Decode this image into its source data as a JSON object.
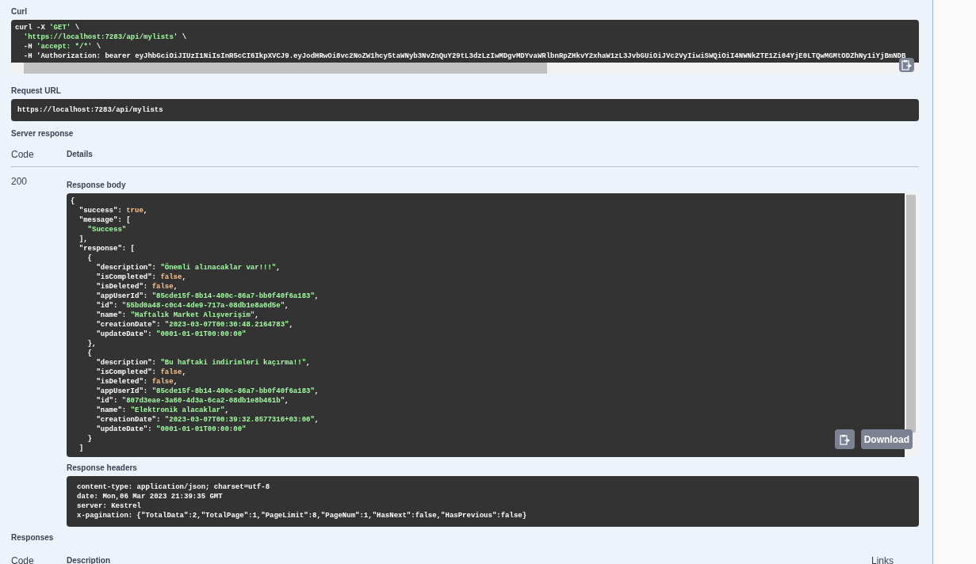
{
  "curl": {
    "label": "Curl",
    "lines": [
      "curl -X 'GET' \\",
      "  'https://localhost:7283/api/mylists' \\",
      "  -H 'accept: */*' \\",
      "  -H 'Authorization: bearer eyJhbGciOiJIUzI1NiIsInR5cCI6IkpXVCJ9.eyJodHRwOi8vc2NoZW1hcy5taWNyb3NvZnQuY29tL3dzLzIwMDgvMDYvaWRlbnRpZHkvY2xhaW1zL3JvbGUiOiJVc2VyIiwiSWQiOiI4NWNkZTE1Zi04YjE0LTQwMGMtODZhNy1iYjBmNDB"
    ]
  },
  "request_url": {
    "label": "Request URL",
    "value": "https://localhost:7283/api/mylists"
  },
  "server_response": {
    "label": "Server response",
    "columns": [
      "Code",
      "Details"
    ],
    "code": "200",
    "response_body": {
      "label": "Response body",
      "download": "Download",
      "lines": [
        "{",
        "  \"success\": true,",
        "  \"message\": [",
        "    \"Success\"",
        "  ],",
        "  \"response\": [",
        "    {",
        "      \"description\": \"Önemli alınacaklar var!!!\",",
        "      \"isCompleted\": false,",
        "      \"isDeleted\": false,",
        "      \"appUserId\": \"85cde15f-8b14-400c-86a7-bb0f40f6a183\",",
        "      \"id\": \"55bd0a48-c0c4-4de9-717a-08db1e8a0d5e\",",
        "      \"name\": \"Haftalık Market Alışverişim\",",
        "      \"creationDate\": \"2023-03-07T00:30:48.2164783\",",
        "      \"updateDate\": \"0001-01-01T00:00:00\"",
        "    },",
        "    {",
        "      \"description\": \"Bu haftaki indirimleri kaçırma!!\",",
        "      \"isCompleted\": false,",
        "      \"isDeleted\": false,",
        "      \"appUserId\": \"85cde15f-8b14-400c-86a7-bb0f40f6a183\",",
        "      \"id\": \"807d3eae-3a60-4d3a-6ca2-08db1e8b461b\",",
        "      \"name\": \"Elektronik alacaklar\",",
        "      \"creationDate\": \"2023-03-07T00:39:32.8577316+03:00\",",
        "      \"updateDate\": \"0001-01-01T00:00:00\"",
        "    }",
        "  ]"
      ]
    },
    "response_headers": {
      "label": "Response headers",
      "lines": [
        "content-type: application/json; charset=utf-8",
        "date: Mon,06 Mar 2023 21:39:35 GMT",
        "server: Kestrel",
        "x-pagination: {\"TotalData\":2,\"TotalPage\":1,\"PageLimit\":8,\"PageNum\":1,\"HasNext\":false,\"HasPrevious\":false}"
      ]
    }
  },
  "responses": {
    "label": "Responses",
    "columns": [
      "Code",
      "Description",
      "Links"
    ]
  }
}
